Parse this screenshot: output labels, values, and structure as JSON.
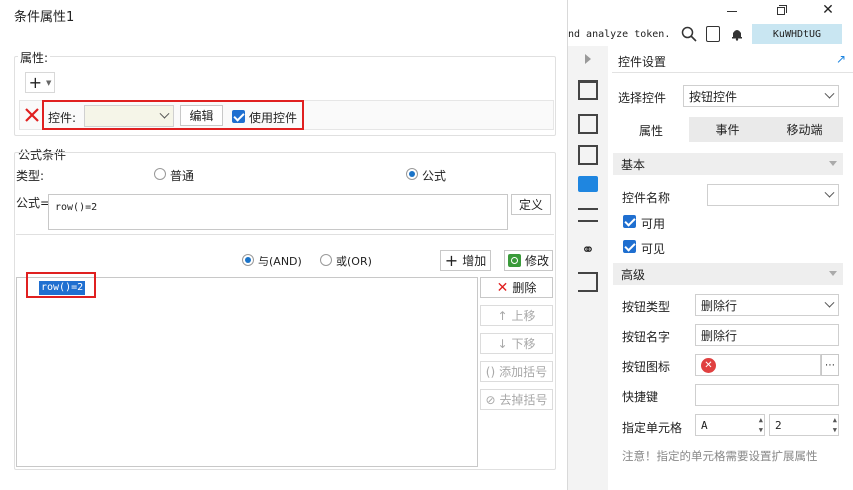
{
  "dialog": {
    "title": "条件属性1",
    "attributes": {
      "group_label": "属性:",
      "control_label": "控件:",
      "edit_label": "编辑",
      "use_control_label": "使用控件"
    },
    "formula_condition": {
      "group_label": "公式条件",
      "type_label": "类型:",
      "normal_label": "普通",
      "formula_label": "公式",
      "formula_eq_label": "公式=",
      "formula_value": "row()=2",
      "define_label": "定义",
      "and_label": "与(AND)",
      "or_label": "或(OR)",
      "add_label": "增加",
      "modify_label": "修改",
      "list_items": [
        "row()=2"
      ],
      "delete_label": "删除",
      "move_up_label": "上移",
      "move_down_label": "下移",
      "add_bracket_label": "添加括号",
      "remove_bracket_label": "去掉括号"
    }
  },
  "toolbar": {
    "partial_text": "nd analyze token.",
    "user_badge": "KuWHDtUG"
  },
  "panel": {
    "title": "控件设置",
    "select_control_label": "选择控件",
    "select_control_value": "按钮控件",
    "tabs": [
      "属性",
      "事件",
      "移动端"
    ],
    "basic_section": "基本",
    "control_name_label": "控件名称",
    "control_name_value": "",
    "enabled_label": "可用",
    "visible_label": "可见",
    "advanced_section": "高级",
    "button_type_label": "按钮类型",
    "button_type_value": "删除行",
    "button_name_label": "按钮名字",
    "button_name_value": "删除行",
    "button_icon_label": "按钮图标",
    "shortcut_label": "快捷键",
    "cell_label": "指定单元格",
    "cell_col": "A",
    "cell_row": "2",
    "note": "注意！指定的单元格需要设置扩展属性"
  },
  "colors": {
    "accent": "#1a73c8",
    "highlight": "#e02020",
    "selection": "#1f6fd0"
  }
}
